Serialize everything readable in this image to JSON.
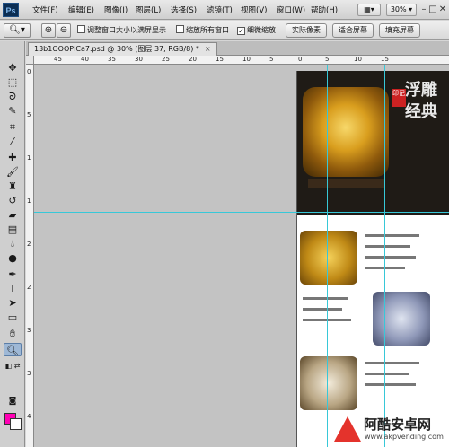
{
  "app": {
    "logo": "Ps"
  },
  "menu": {
    "items": [
      "文件(F)",
      "编辑(E)",
      "图像(I)",
      "图层(L)",
      "选择(S)",
      "滤镜(T)",
      "视图(V)",
      "窗口(W)",
      "帮助(H)"
    ],
    "zoom": "30%",
    "window_controls": [
      "–",
      "□",
      "✕"
    ]
  },
  "options": {
    "checkboxes": [
      {
        "label": "调整窗口大小以满屏显示",
        "checked": false
      },
      {
        "label": "缩放所有窗口",
        "checked": false
      },
      {
        "label": "细微缩放",
        "checked": true
      }
    ],
    "buttons": [
      "实际像素",
      "适合屏幕",
      "填充屏幕"
    ]
  },
  "document": {
    "tab_title": "13b1OOOPICa7.psd @ 30% (图层 37, RGB/8) *",
    "close": "×"
  },
  "ruler": {
    "top_labels": [
      "45",
      "40",
      "35",
      "30",
      "25",
      "20",
      "15",
      "10",
      "5",
      "0",
      "5",
      "10",
      "15"
    ],
    "left_labels": [
      "0",
      "5",
      "1",
      "1",
      "2",
      "2",
      "3",
      "3",
      "4"
    ]
  },
  "artwork": {
    "title_chars": "浮雕经典",
    "seal": "印记"
  },
  "colors": {
    "foreground": "#ff00b4",
    "background": "#ffffff",
    "guide": "#37c8d8"
  },
  "watermark": {
    "title": "阿酷安卓网",
    "url": "www.akpvending.com"
  }
}
